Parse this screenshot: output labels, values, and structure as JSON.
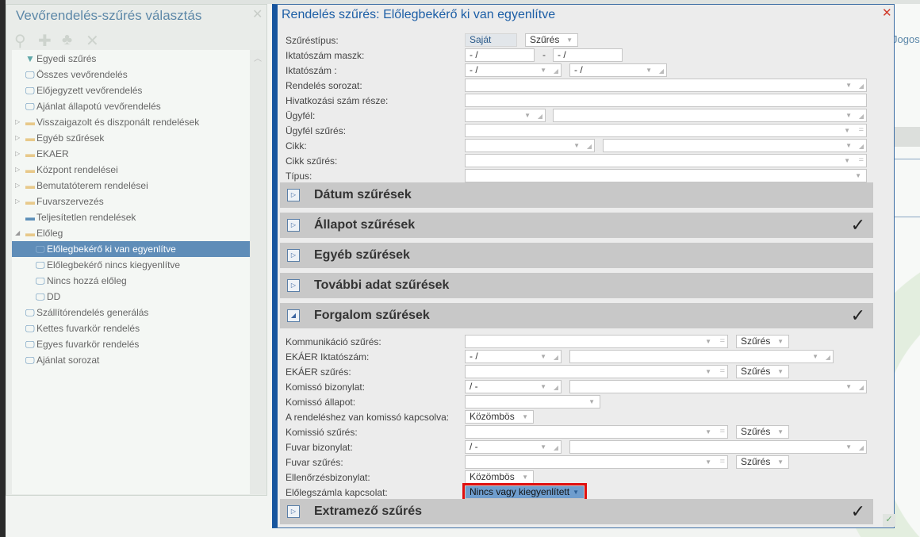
{
  "left_panel": {
    "title": "Vevőrendelés-szűrés választás",
    "tree": [
      {
        "label": "Egyedi szűrés",
        "icon": "filter-icon",
        "level": 0
      },
      {
        "label": "Összes vevőrendelés",
        "icon": "monitor-icon",
        "level": 0
      },
      {
        "label": "Előjegyzett vevőrendelés",
        "icon": "monitor-icon",
        "level": 0
      },
      {
        "label": "Ajánlat állapotú vevőrendelés",
        "icon": "monitor-icon",
        "level": 0
      },
      {
        "label": "Visszaigazolt és diszponált rendelések",
        "icon": "folder-icon",
        "level": 0,
        "expander": "collapsed"
      },
      {
        "label": "Egyéb szűrések",
        "icon": "folder-icon",
        "level": 0,
        "expander": "collapsed"
      },
      {
        "label": "EKAER",
        "icon": "folder-icon",
        "level": 0,
        "expander": "collapsed"
      },
      {
        "label": "Központ rendelései",
        "icon": "folder-icon",
        "level": 0,
        "expander": "collapsed"
      },
      {
        "label": "Bemutatóterem rendelései",
        "icon": "folder-icon",
        "level": 0,
        "expander": "collapsed"
      },
      {
        "label": "Fuvarszervezés",
        "icon": "folder-icon",
        "level": 0,
        "expander": "collapsed"
      },
      {
        "label": "Teljesítetlen rendelések",
        "icon": "printer-icon",
        "level": 0
      },
      {
        "label": "Előleg",
        "icon": "folder-icon",
        "level": 0,
        "expander": "expanded"
      },
      {
        "label": "Előlegbekérő ki van egyenlítve",
        "icon": "monitor-icon",
        "level": 1,
        "selected": true
      },
      {
        "label": "Előlegbekérő nincs kiegyenlítve",
        "icon": "monitor-icon",
        "level": 1
      },
      {
        "label": "Nincs hozzá előleg",
        "icon": "monitor-icon",
        "level": 1
      },
      {
        "label": "DD",
        "icon": "monitor-icon",
        "level": 1
      },
      {
        "label": "Szállítórendelés generálás",
        "icon": "monitor-gen-icon",
        "level": 0
      },
      {
        "label": "Kettes fuvarkör rendelés",
        "icon": "monitor-icon",
        "level": 0
      },
      {
        "label": "Egyes fuvarkör rendelés",
        "icon": "monitor-icon",
        "level": 0
      },
      {
        "label": "Ajánlat sorozat",
        "icon": "monitor-gen-icon",
        "level": 0
      }
    ]
  },
  "background": {
    "right_text": "Jogos"
  },
  "dialog": {
    "title": "Rendelés szűrés: Előlegbekérő ki van egyenlítve",
    "top_rows": [
      {
        "label": "Szűréstípus:",
        "fields": [
          "Saját",
          "Szűrés"
        ]
      },
      {
        "label": "Iktatószám maszk:",
        "fields": [
          "- /",
          "- /"
        ],
        "separator": "-"
      },
      {
        "label": "Iktatószám :",
        "fields": [
          "- /",
          "- /"
        ]
      },
      {
        "label": "Rendelés sorozat:",
        "fields": [
          ""
        ]
      },
      {
        "label": "Hivatkozási szám része:",
        "fields": [
          ""
        ]
      },
      {
        "label": "Ügyfél:",
        "fields": [
          "",
          ""
        ]
      },
      {
        "label": "Ügyfél szűrés:",
        "fields": [
          ""
        ]
      },
      {
        "label": "Cikk:",
        "fields": [
          "",
          ""
        ]
      },
      {
        "label": "Cikk szűrés:",
        "fields": [
          ""
        ]
      },
      {
        "label": "Típus:",
        "fields": [
          ""
        ]
      }
    ],
    "sections": [
      {
        "title": "Dátum szűrések",
        "expanded": false,
        "checked": false
      },
      {
        "title": "Állapot szűrések",
        "expanded": false,
        "checked": true
      },
      {
        "title": "Egyéb szűrések",
        "expanded": false,
        "checked": false
      },
      {
        "title": "További adat szűrések",
        "expanded": false,
        "checked": false
      },
      {
        "title": "Forgalom szűrések",
        "expanded": true,
        "checked": true
      }
    ],
    "forgalom_rows": [
      {
        "label": "Kommunikáció szűrés:",
        "fields": [
          "",
          "Szűrés"
        ]
      },
      {
        "label": "EKÁER Iktatószám:",
        "fields": [
          "- /",
          ""
        ]
      },
      {
        "label": "EKÁER szűrés:",
        "fields": [
          "",
          "Szűrés"
        ]
      },
      {
        "label": "Komissó bizonylat:",
        "fields": [
          "/ -",
          ""
        ]
      },
      {
        "label": "Komissó állapot:",
        "fields": [
          ""
        ]
      },
      {
        "label": "A rendeléshez van komissó kapcsolva:",
        "fields": [
          "Közömbös"
        ]
      },
      {
        "label": "Komissió szűrés:",
        "fields": [
          "",
          "Szűrés"
        ]
      },
      {
        "label": "Fuvar bizonylat:",
        "fields": [
          "/ -",
          ""
        ]
      },
      {
        "label": "Fuvar szűrés:",
        "fields": [
          "",
          "Szűrés"
        ]
      },
      {
        "label": "Ellenőrzésbizonylat:",
        "fields": [
          "Közömbös"
        ]
      },
      {
        "label": "Előlegszámla kapcsolat:",
        "fields": [
          "Nincs vagy kiegyenlített"
        ]
      }
    ],
    "extra_section": {
      "title": "Extramező szűrés",
      "expanded": false,
      "checked": true
    }
  }
}
